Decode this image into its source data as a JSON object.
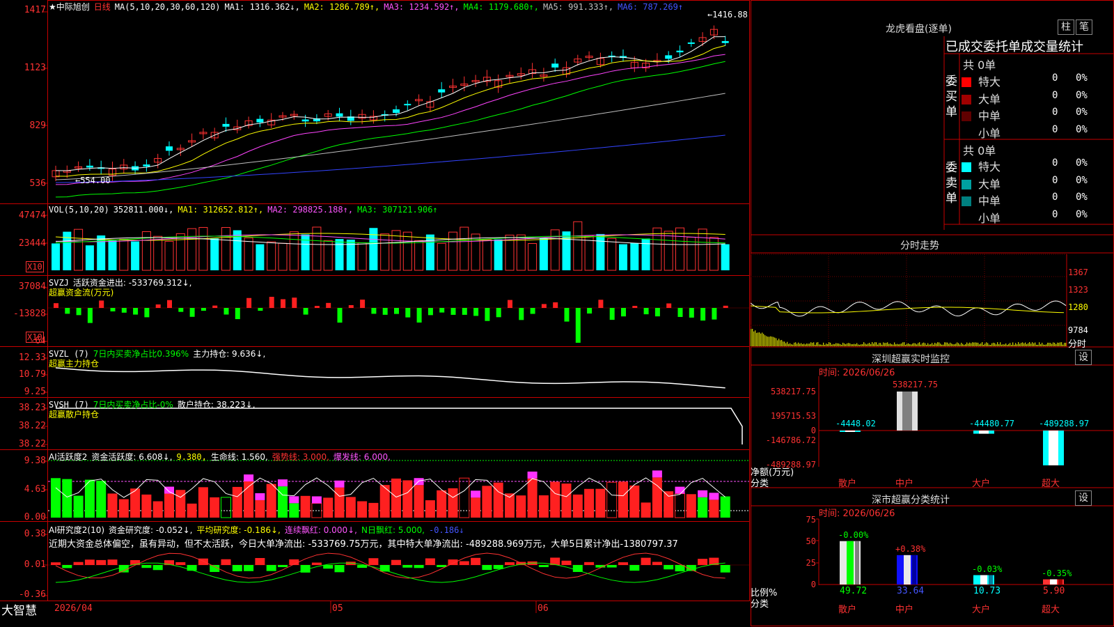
{
  "main": {
    "stock_name": "★中际旭创",
    "period": "日线",
    "ma_params": "MA(5,10,20,30,60,120)",
    "ma1": "MA1: 1316.362↓,",
    "ma2": "MA2: 1286.789↑,",
    "ma3": "MA3: 1234.592↑,",
    "ma4": "MA4: 1179.680↑,",
    "ma5": "MA5: 991.333↑,",
    "ma6": "MA6: 787.269↑",
    "y_ticks": [
      "1417",
      "1123",
      "829",
      "536"
    ],
    "high_marker": "←1416.88",
    "low_marker": "←554.00",
    "ma_colors": {
      "ma1": "#ffffff",
      "ma2": "#ffff00",
      "ma3": "#ff44ff",
      "ma4": "#00ff00",
      "ma5": "#c0c0c0",
      "ma6": "#3344ff"
    }
  },
  "vol": {
    "label": "VOL(5,10,20)",
    "value": "352811.000↓,",
    "ma1": "MA1: 312652.812↑,",
    "ma2": "MA2: 298825.188↑,",
    "ma3": "MA3: 307121.906↑",
    "y_ticks": [
      "47474",
      "23444"
    ],
    "unit_badge": "X10"
  },
  "svzj": {
    "label": "SVZJ",
    "title": "活跃资金进出: -533769.312↓,",
    "subtitle": "超赢资金流(万元)",
    "y_ticks": [
      "37084",
      "-13828",
      "-64"
    ],
    "unit_badge": "X10"
  },
  "svzl": {
    "label": "SVZL (7)",
    "t1": "7日内买卖净占比0.396%",
    "t2": "主力持仓: 9.636↓,",
    "subtitle": "超赢主力持仓",
    "y_ticks": [
      "12.33",
      "10.79",
      "9.25"
    ]
  },
  "svsh": {
    "label": "SVSH (7)",
    "t1": "7日内买卖净占比-0%",
    "t2": "散户持仓: 38.223↓,",
    "subtitle": "超赢散户持仓",
    "y_ticks": [
      "38.23",
      "38.22",
      "38.22"
    ]
  },
  "ai1": {
    "label": "AI活跃度2",
    "t1": "资金活跃度: 6.608↓,",
    "t2": "9.380,",
    "t3": "生命线: 1.560,",
    "t4": "强势线: 3.000,",
    "t5": "爆发线: 6.000,",
    "y_ticks": [
      "9.38",
      "4.63",
      "0.00"
    ]
  },
  "ai2": {
    "label": "AI研究度2(10)",
    "t1": "资金研究度: -0.052↓,",
    "t2": "平均研究度: -0.186↓,",
    "t3": "连续飘红: 0.000↓,",
    "t4": "N日飘红: 5.000,",
    "t5": "-0.186↓",
    "comment": "近期大资金总体偏空，虽有异动，但不太活跃，今日大单净流出: -533769.75万元，其中特大单净流出: -489288.969万元，大单5日累计净出-1380797.37",
    "y_ticks": [
      "0.38",
      "0.01",
      "-0.36"
    ]
  },
  "footer": {
    "brand": "大智慧",
    "date_start": "2026/04",
    "m1": "05",
    "m2": "06"
  },
  "right": {
    "lhkp_title": "龙虎看盘(逐单)",
    "btn_col": "柱",
    "btn_pen": "笔",
    "stat_title": "已成交委托单成交量统计",
    "buy_label": "委买单",
    "sell_label": "委卖单",
    "buy_total": "共 0单",
    "sell_total": "共 0单",
    "buy_rows": [
      {
        "name": "特大",
        "v": "0",
        "p": "0%",
        "color": "#ff0000"
      },
      {
        "name": "大单",
        "v": "0",
        "p": "0%",
        "color": "#a00000"
      },
      {
        "name": "中单",
        "v": "0",
        "p": "0%",
        "color": "#600000"
      },
      {
        "name": "小单",
        "v": "0",
        "p": "0%",
        "color": "#000000"
      }
    ],
    "sell_rows": [
      {
        "name": "特大",
        "v": "0",
        "p": "0%",
        "color": "#00ffff"
      },
      {
        "name": "大单",
        "v": "0",
        "p": "0%",
        "color": "#00a0a0"
      },
      {
        "name": "中单",
        "v": "0",
        "p": "0%",
        "color": "#008080"
      },
      {
        "name": "小单",
        "v": "0",
        "p": "0%",
        "color": "#000000"
      }
    ],
    "fenshi_title": "分时走势",
    "fenshi_ticks": [
      "1367",
      "1323",
      "1280",
      "9784"
    ],
    "fenshi_unit": "分时",
    "sz_title": "深圳超赢实时监控",
    "sz_btn": "设",
    "sz_time": "时间: 2026/06/26",
    "sz_yticks": [
      "538217.75",
      "195715.53",
      "0",
      "-146786.72",
      "-489288.97"
    ],
    "sz_netlabel": "净额(万元)",
    "sz_cat": "分类",
    "sz_bars": [
      {
        "cat": "散户",
        "val": -4448.02,
        "label": "-4448.02"
      },
      {
        "cat": "中户",
        "val": 538217.75,
        "label": "538217.75"
      },
      {
        "cat": "大户",
        "val": -44480.77,
        "label": "-44480.77"
      },
      {
        "cat": "超大",
        "val": -489288.97,
        "label": "-489288.97"
      }
    ],
    "cl_title": "深市超赢分类统计",
    "cl_btn": "设",
    "cl_time": "时间: 2026/06/26",
    "cl_yticks": [
      "75",
      "50",
      "25",
      "0"
    ],
    "cl_ratio": "比例%",
    "cl_cat": "分类",
    "cl_bars": [
      {
        "cat": "散户",
        "val": 49.72,
        "chg": "-0.00%"
      },
      {
        "cat": "中户",
        "val": 33.64,
        "chg": "+0.38%"
      },
      {
        "cat": "大户",
        "val": 10.73,
        "chg": "-0.03%"
      },
      {
        "cat": "超大",
        "val": 5.9,
        "chg": "-0.35%"
      }
    ],
    "cl_vals": [
      "49.72",
      "33.64",
      "10.73",
      "5.90"
    ]
  }
}
